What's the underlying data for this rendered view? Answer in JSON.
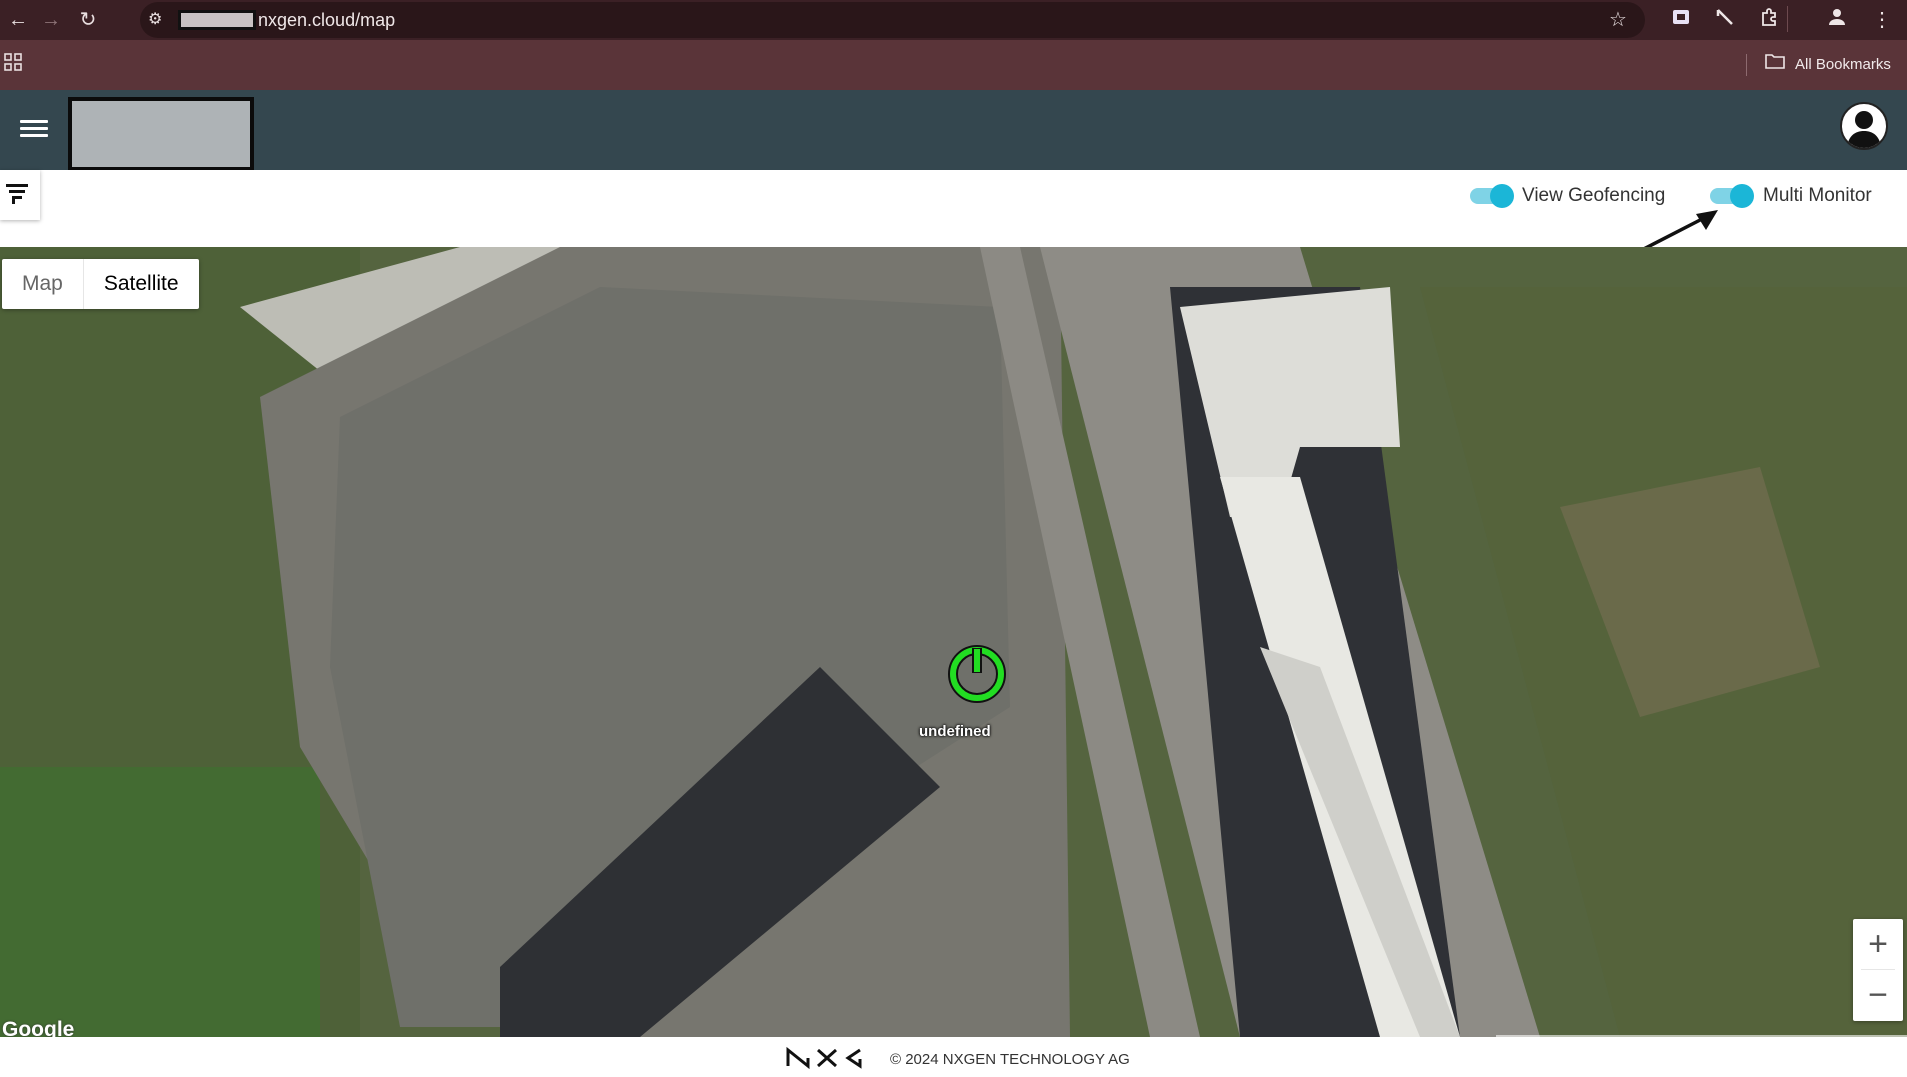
{
  "browser": {
    "url": "nxgen.cloud/map",
    "bookmarks_label": "All Bookmarks",
    "icons": [
      "back-icon",
      "forward-icon",
      "reload-icon",
      "site-info-icon",
      "star-icon",
      "extension-icon",
      "line-tool-icon",
      "puzzle-icon",
      "profile-icon",
      "more-icon",
      "apps-icon",
      "folder-icon"
    ]
  },
  "header": {
    "menu_icon": "hamburger-icon",
    "avatar_icon": "user-avatar-icon"
  },
  "toolbar": {
    "geofencing_label": "View Geofencing",
    "geofencing_on": true,
    "multi_monitor_label": "Multi Monitor",
    "multi_monitor_on": true,
    "toggle_color": "#1bb6d7"
  },
  "map": {
    "type_options": [
      "Map",
      "Satellite"
    ],
    "selected_type": "Satellite",
    "marker_label": "undefined",
    "marker_color": "#22dd22",
    "zoom_in": "+",
    "zoom_out": "−",
    "provider": "Google"
  },
  "footer": {
    "logo_text": "NXG",
    "copyright": "© 2024 NXGEN TECHNOLOGY AG"
  },
  "colors": {
    "browser_bar": "#3b2025",
    "app_header": "#34474f"
  }
}
